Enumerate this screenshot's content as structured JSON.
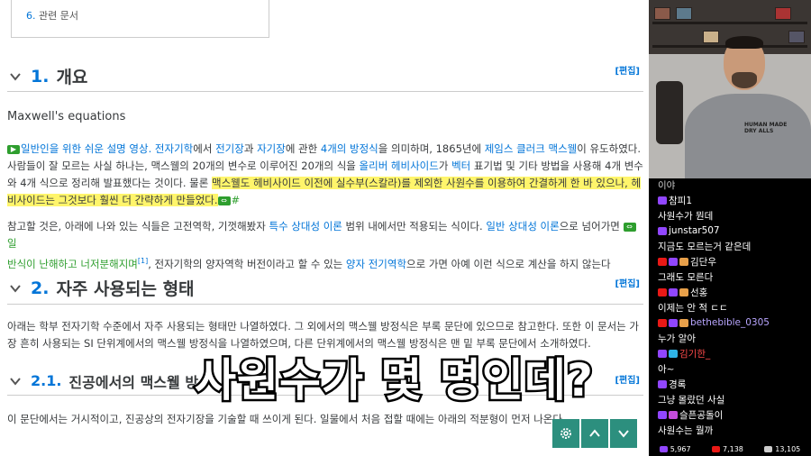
{
  "toc": {
    "item_num": "6.",
    "item_label": "관련 문서"
  },
  "sections": {
    "s1": {
      "num": "1.",
      "title": "개요",
      "edit": "[편집]"
    },
    "s2": {
      "num": "2.",
      "title": "자주 사용되는 형태",
      "edit": "[편집]"
    },
    "s21": {
      "num": "2.1.",
      "title": "진공에서의 맥스웰 방",
      "edit": "[편집]"
    }
  },
  "maxwell_title": "Maxwell's equations",
  "para1": {
    "ext1": "일반인을 위한 쉬운 설명 영상.",
    "l_elec": "전자기학",
    "t1": "에서",
    "l_efield": "전기장",
    "t2": "과",
    "l_mfield": "자기장",
    "t3": "에 관한",
    "l_four": "4개의 방정식",
    "t4": "을 의미하며, 1865년에",
    "l_jcm": "제임스 클러크 맥스웰",
    "t5": "이 유도하였다.",
    "line2a": "사람들이 잘 모르는 사실 하나는, 맥스웰의 20개의 변수로 이루어진 20개의 식을",
    "l_heaviside": "올리버 헤비사이드",
    "t6": "가",
    "l_vector": "벡터",
    "t7": "표기법 및 기타 방법을 사용해 4개 변수",
    "line3a": "와 4개 식으로 정리해 발표했다는 것이다. 물론",
    "hl1": "맥스웰도 헤비사이드 이전에 실수부(스칼라)를 제외한 사원수를 이용하여 간결하게 한 바 있으나, 헤",
    "hl2": "비사이드는 그것보다 훨씬 더 간략하게 만들었다.",
    "hash": "#"
  },
  "para2": {
    "t1": "참고할 것은, 아래에 나와 있는 식들은 고전역학, 기껏해봤자",
    "l_sr": "특수 상대성 이론",
    "t2": "범위 내에서만 적용되는 식이다.",
    "l_gr": "일반 상대성 이론",
    "t3": "으로 넘어가면",
    "g1": "일",
    "g2": "반식이 난해하고 너저분해지며",
    "sup": "[1]",
    "t4": ", 전자기학의 양자역학 버전이라고 할 수 있는",
    "l_qed": "양자 전기역학",
    "t5": "으로 가면 아예 이런 식으로 계산을 하지 않는다"
  },
  "para3": {
    "line1": "아래는 학부 전자기학 수준에서 자주 사용되는 형태만 나열하였다. 그 외에서의 맥스웰 방정식은 부록 문단에 있으므로 참고한다. 또한 이 문서는 가",
    "line2": "장 흔히 사용되는 SI 단위계에서의 맥스웰 방정식을 나열하였으며, 다른 단위계에서의 맥스웰 방정식은 맨 밑 부록 문단에서 소개하였다."
  },
  "para4": "이 문단에서는 거시적이고, 진공상의 전자기장을 기술할 때 쓰이게 된다. 일물에서 처음 접할 때에는 아래의 적분형이 먼저 나온다.",
  "subtitle": "사원수가 몇 명인데?",
  "cam": {
    "shirt_line1": "HUMAN MADE",
    "shirt_line2": "DRY ALLS"
  },
  "chat": {
    "top_partial": "이야",
    "messages": [
      {
        "name": "참피1",
        "text": "사원수가 뭔데",
        "color": "#ffffff"
      },
      {
        "name": "junstar507",
        "text": "지금도 모르는거 같은데",
        "color": "#ffffff"
      },
      {
        "name": "김단우",
        "text": "그래도 모른다",
        "color": "#ffffff"
      },
      {
        "name": "선홍",
        "text": "이제는 안 적 ㄷㄷ",
        "color": "#ffffff"
      },
      {
        "name": "bethebible_0305",
        "text": "누가 알아",
        "color": "#b9a6ff"
      },
      {
        "name": "김기한_",
        "text": "아~",
        "color": "#ff4a4a"
      },
      {
        "name": "경록",
        "text": "그냥 몰랐던 사실",
        "color": "#ffffff"
      },
      {
        "name": "슬픈공돌이",
        "text": "사원수는 뭘까",
        "color": "#ffffff"
      }
    ]
  },
  "stats": {
    "viewers": "5,967",
    "likes": "7,138",
    "followers": "13,105"
  },
  "colors": {
    "link": "#0275d8",
    "highlight": "#fff56b",
    "button": "#2c8f7e"
  }
}
